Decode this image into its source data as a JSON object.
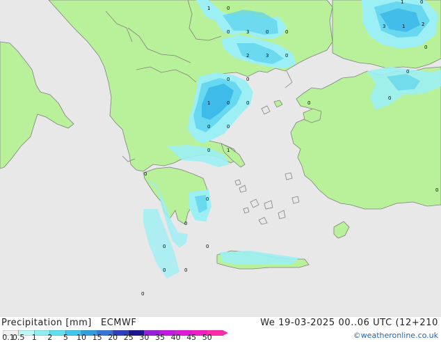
{
  "header": {
    "title": "Precipitation [mm]",
    "model": "ECMWF",
    "valid": "We 19-03-2025 00..06 UTC (12+210",
    "credit": "©weatheronline.co.uk"
  },
  "legend": {
    "labels": [
      "0.1",
      "0.5",
      "1",
      "2",
      "5",
      "10",
      "15",
      "20",
      "25",
      "30",
      "35",
      "40",
      "45",
      "50"
    ],
    "colors": [
      "#f0f0f0",
      "#bff5f7",
      "#8eeef4",
      "#5fdff0",
      "#3fc4eb",
      "#2f9fe0",
      "#3675d6",
      "#2d3fc0",
      "#1a168f",
      "#9a1ee0",
      "#c317e8",
      "#e018d8",
      "#f21cc6",
      "#ff2aa8"
    ]
  },
  "map": {
    "colors": {
      "sea": "#e8e8e8",
      "land": "#b9f19a",
      "coast": "#808080",
      "precip_light": "#9ceff4",
      "precip_med": "#5fd3ee",
      "precip_heavy": "#38b6e8"
    },
    "values": [
      {
        "text": "1"
      },
      {
        "text": "0"
      },
      {
        "text": "0"
      },
      {
        "text": "3"
      },
      {
        "text": "0"
      },
      {
        "text": "0"
      },
      {
        "text": "2"
      },
      {
        "text": "3"
      },
      {
        "text": "0"
      },
      {
        "text": "0"
      },
      {
        "text": "0"
      },
      {
        "text": "1"
      },
      {
        "text": "0"
      },
      {
        "text": "0"
      },
      {
        "text": "0"
      },
      {
        "text": "0"
      },
      {
        "text": "0"
      },
      {
        "text": "1"
      },
      {
        "text": "0"
      },
      {
        "text": "0"
      },
      {
        "text": "0"
      },
      {
        "text": "0"
      },
      {
        "text": "0"
      },
      {
        "text": "0"
      },
      {
        "text": "0"
      },
      {
        "text": "0"
      },
      {
        "text": "0"
      },
      {
        "text": "1"
      },
      {
        "text": "3"
      },
      {
        "text": "1"
      },
      {
        "text": "2"
      },
      {
        "text": "0"
      },
      {
        "text": "0"
      },
      {
        "text": "0"
      },
      {
        "text": "0"
      },
      {
        "text": "0"
      }
    ]
  }
}
